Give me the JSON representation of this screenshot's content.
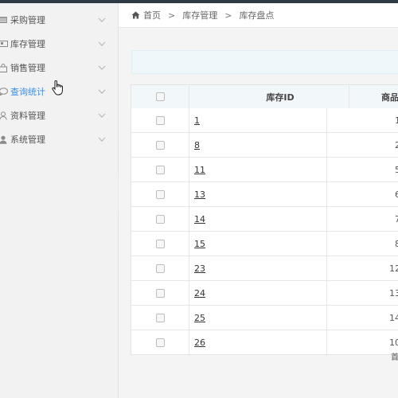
{
  "sidebar": {
    "items": [
      {
        "label": "采购管理",
        "icon": "list-icon",
        "active": false
      },
      {
        "label": "库存管理",
        "icon": "card-icon",
        "active": false
      },
      {
        "label": "销售管理",
        "icon": "bag-icon",
        "active": false
      },
      {
        "label": "查询统计",
        "icon": "chat-icon",
        "active": true
      },
      {
        "label": "资料管理",
        "icon": "user-outline-icon",
        "active": false
      },
      {
        "label": "系统管理",
        "icon": "user-icon",
        "active": false
      }
    ]
  },
  "breadcrumb": {
    "home": "首页",
    "level1": "库存管理",
    "level2": "库存盘点",
    "separator": ">"
  },
  "table": {
    "columns": {
      "id": "库存ID",
      "goods": "商品"
    },
    "rows": [
      {
        "id": "1",
        "goods": "1"
      },
      {
        "id": "8",
        "goods": "2"
      },
      {
        "id": "11",
        "goods": "5"
      },
      {
        "id": "13",
        "goods": "6"
      },
      {
        "id": "14",
        "goods": "7"
      },
      {
        "id": "15",
        "goods": "8"
      },
      {
        "id": "23",
        "goods": "12"
      },
      {
        "id": "24",
        "goods": "13"
      },
      {
        "id": "25",
        "goods": "14"
      },
      {
        "id": "26",
        "goods": "10"
      }
    ]
  },
  "pager": {
    "first": "首"
  },
  "colors": {
    "accent": "#3a8ee6",
    "topbar": "#2e3a46",
    "sidebar_bg": "#f2f2f2",
    "table_head_bg": "#f2f7fa",
    "notice_bg": "#eef8fb"
  }
}
